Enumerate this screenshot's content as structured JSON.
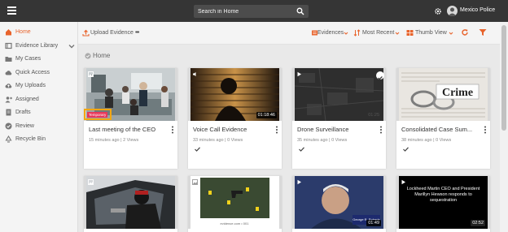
{
  "header": {
    "search_placeholder": "Search in Home",
    "username": "Mexico Police"
  },
  "sidebar": {
    "items": [
      {
        "label": "Home",
        "icon": "home-icon"
      },
      {
        "label": "Evidence Library",
        "icon": "library-icon"
      },
      {
        "label": "My Cases",
        "icon": "folder-icon"
      },
      {
        "label": "Quick Access",
        "icon": "cloud-icon"
      },
      {
        "label": "My Uploads",
        "icon": "upload-cloud-icon"
      },
      {
        "label": "Assigned",
        "icon": "assigned-icon"
      },
      {
        "label": "Drafts",
        "icon": "draft-icon"
      },
      {
        "label": "Review",
        "icon": "review-icon"
      },
      {
        "label": "Recycle Bin",
        "icon": "recycle-icon"
      }
    ]
  },
  "toolbar": {
    "upload_label": "Upload Evidence",
    "more": "•••",
    "filter_label": "Evidences",
    "sort_label": "Most Recent",
    "view_label": "Thumb View"
  },
  "content": {
    "title": "Home"
  },
  "cards": [
    {
      "title": "Last meeting of the CEO",
      "meta": "15 minutes ago  |  2 Views",
      "badge": "Temporary",
      "duration": ""
    },
    {
      "title": "Voice Call Evidence",
      "meta": "33 minutes ago  |  0 Views",
      "duration": "01:18:46"
    },
    {
      "title": "Drone Surveillance",
      "meta": "35 minutes ago  |  0 Views",
      "duration": "01:25"
    },
    {
      "title": "Consolidated Case Sum...",
      "meta": "38 minutes ago  |  0 Views",
      "duration": "",
      "thumb_text": "Crime"
    },
    {
      "title": "",
      "meta": "",
      "duration": ""
    },
    {
      "title": "",
      "meta": "",
      "duration": "",
      "thumb_text": "evidence.com • 001"
    },
    {
      "title": "",
      "meta": "",
      "duration": "01:49",
      "thumb_text": "George R. Roberts"
    },
    {
      "title": "",
      "meta": "",
      "duration": "02:52",
      "thumb_text": "Lockheed Martin CEO and President Marillyn Hewson responds to sequestration"
    }
  ],
  "colors": {
    "accent": "#e8632b",
    "topbar": "#353535",
    "temporary_badge": "#e8385a",
    "badge_outline": "#f3a712"
  }
}
